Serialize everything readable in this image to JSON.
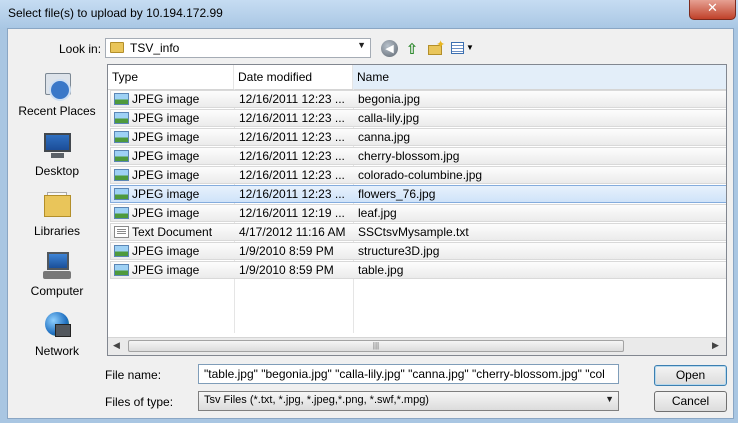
{
  "window": {
    "title": "Select file(s) to upload by 10.194.172.99",
    "close_label": "✕"
  },
  "toolbar": {
    "look_in_label": "Look in:",
    "look_in_value": "TSV_info",
    "dropdown_glyph": "▼",
    "back_glyph": "◀",
    "up_glyph": "⇧",
    "new_folder_glyph": "✦",
    "views_glyph": "▼"
  },
  "places": [
    {
      "label": "Recent Places",
      "icon": "recent-places-icon"
    },
    {
      "label": "Desktop",
      "icon": "desktop-icon"
    },
    {
      "label": "Libraries",
      "icon": "libraries-icon"
    },
    {
      "label": "Computer",
      "icon": "computer-icon"
    },
    {
      "label": "Network",
      "icon": "network-icon"
    }
  ],
  "columns": {
    "type": "Type",
    "date": "Date modified",
    "name": "Name",
    "sort_glyph": "▲"
  },
  "files": [
    {
      "type": "JPEG image",
      "date": "12/16/2011 12:23 ...",
      "name": "begonia.jpg",
      "icon": "jpeg-file-icon",
      "selected": false
    },
    {
      "type": "JPEG image",
      "date": "12/16/2011 12:23 ...",
      "name": "calla-lily.jpg",
      "icon": "jpeg-file-icon",
      "selected": false
    },
    {
      "type": "JPEG image",
      "date": "12/16/2011 12:23 ...",
      "name": "canna.jpg",
      "icon": "jpeg-file-icon",
      "selected": false
    },
    {
      "type": "JPEG image",
      "date": "12/16/2011 12:23 ...",
      "name": "cherry-blossom.jpg",
      "icon": "jpeg-file-icon",
      "selected": false
    },
    {
      "type": "JPEG image",
      "date": "12/16/2011 12:23 ...",
      "name": "colorado-columbine.jpg",
      "icon": "jpeg-file-icon",
      "selected": false
    },
    {
      "type": "JPEG image",
      "date": "12/16/2011 12:23 ...",
      "name": "flowers_76.jpg",
      "icon": "jpeg-file-icon",
      "selected": true
    },
    {
      "type": "JPEG image",
      "date": "12/16/2011 12:19 ...",
      "name": "leaf.jpg",
      "icon": "jpeg-file-icon",
      "selected": false
    },
    {
      "type": "Text Document",
      "date": "4/17/2012 11:16 AM",
      "name": "SSCtsvMysample.txt",
      "icon": "text-file-icon",
      "selected": false
    },
    {
      "type": "JPEG image",
      "date": "1/9/2010 8:59 PM",
      "name": "structure3D.jpg",
      "icon": "jpeg-file-icon",
      "selected": false
    },
    {
      "type": "JPEG image",
      "date": "1/9/2010 8:59 PM",
      "name": "table.jpg",
      "icon": "jpeg-file-icon",
      "selected": false
    }
  ],
  "scrollbar": {
    "left_glyph": "◀",
    "right_glyph": "▶",
    "grip_glyph": "|||"
  },
  "file_name": {
    "label": "File name:",
    "value": "\"table.jpg\" \"begonia.jpg\" \"calla-lily.jpg\" \"canna.jpg\" \"cherry-blossom.jpg\" \"colorado-"
  },
  "file_type": {
    "label": "Files of type:",
    "value": "Tsv Files (*.txt, *.jpg, *.jpeg,*.png, *.swf,*.mpg)"
  },
  "buttons": {
    "open": "Open",
    "cancel": "Cancel"
  }
}
